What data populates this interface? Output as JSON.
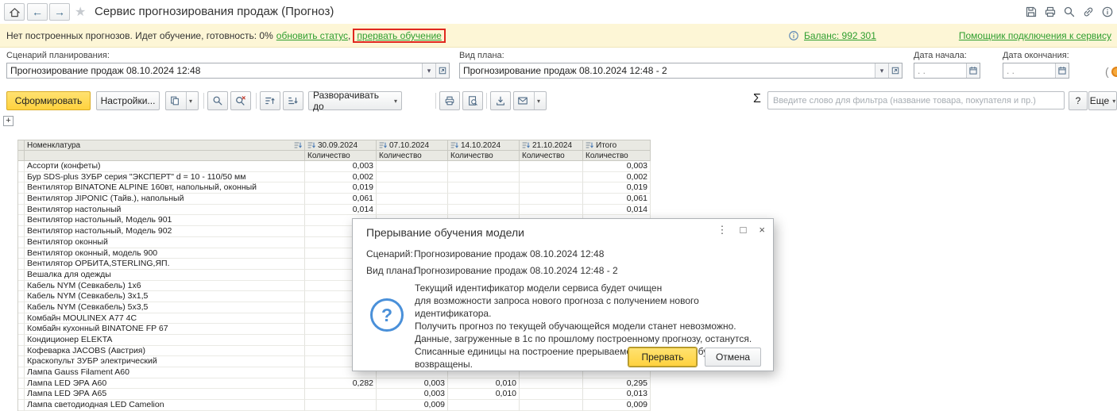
{
  "topbar": {
    "title": "Сервис прогнозирования продаж (Прогноз)"
  },
  "notification": {
    "status": "Нет построенных прогнозов. Идет обучение, готовность: 0%",
    "refresh_link": "обновить статус",
    "comma": ",",
    "interrupt_link": "прервать обучение",
    "balance_link": "Баланс: 992 301",
    "assistant_link": "Помощник подключения к сервису"
  },
  "form": {
    "scenario_label": "Сценарий планирования:",
    "scenario_value": "Прогнозирование продаж 08.10.2024 12:48",
    "plan_label": "Вид плана:",
    "plan_value": "Прогнозирование продаж 08.10.2024 12:48 - 2",
    "date_start_label": "Дата начала:",
    "date_start_value": ". .",
    "date_end_label": "Дата окончания:",
    "date_end_value": ". ."
  },
  "toolbar": {
    "generate_label": "Сформировать",
    "settings_label": "Настройки...",
    "expand_to_label": "Разворачивать до",
    "sigma": "Σ",
    "filter_placeholder": "Введите слово для фильтра (название товара, покупателя и пр.)",
    "help_label": "?",
    "more_label": "Еще"
  },
  "table": {
    "columns": [
      "Номенклатура",
      "30.09.2024",
      "07.10.2024",
      "14.10.2024",
      "21.10.2024",
      "Итого"
    ],
    "quantity_subheader": "Количество",
    "rows": [
      {
        "name": "Ассорти (конфеты)",
        "values": [
          "0,003",
          "",
          "",
          "",
          "0,003"
        ]
      },
      {
        "name": "Бур SDS-plus ЗУБР серия \"ЭКСПЕРТ\" d = 10 - 110/50 мм",
        "values": [
          "0,002",
          "",
          "",
          "",
          "0,002"
        ]
      },
      {
        "name": "Вентилятор BINATONE ALPINE 160вт, напольный, оконный",
        "values": [
          "0,019",
          "",
          "",
          "",
          "0,019"
        ]
      },
      {
        "name": "Вентилятор JIPONIC (Тайв.), напольный",
        "values": [
          "0,061",
          "",
          "",
          "",
          "0,061"
        ]
      },
      {
        "name": "Вентилятор настольный",
        "values": [
          "0,014",
          "",
          "",
          "",
          "0,014"
        ]
      },
      {
        "name": "Вентилятор настольный, Модель 901",
        "values": [
          "",
          "",
          "",
          "",
          ""
        ]
      },
      {
        "name": "Вентилятор настольный, Модель 902",
        "values": [
          "",
          "",
          "",
          "",
          ""
        ]
      },
      {
        "name": "Вентилятор оконный",
        "values": [
          "",
          "",
          "",
          "",
          ""
        ]
      },
      {
        "name": "Вентилятор оконный, модель 900",
        "values": [
          "",
          "",
          "",
          "",
          ""
        ]
      },
      {
        "name": "Вентилятор ОРБИТА,STERLING,ЯП.",
        "values": [
          "",
          "",
          "",
          "",
          ""
        ]
      },
      {
        "name": "Вешалка для одежды",
        "values": [
          "",
          "",
          "",
          "",
          ""
        ]
      },
      {
        "name": "Кабель NYM (Севкабель) 1x6",
        "values": [
          "",
          "",
          "",
          "",
          ""
        ]
      },
      {
        "name": "Кабель NYM (Севкабель) 3x1,5",
        "values": [
          "",
          "",
          "",
          "",
          ""
        ]
      },
      {
        "name": "Кабель NYM (Севкабель) 5x3,5",
        "values": [
          "",
          "",
          "",
          "",
          ""
        ]
      },
      {
        "name": "Комбайн MOULINEX А77 4С",
        "values": [
          "",
          "",
          "",
          "",
          ""
        ]
      },
      {
        "name": "Комбайн кухонный BINATONE FP 67",
        "values": [
          "",
          "",
          "",
          "",
          ""
        ]
      },
      {
        "name": "Кондиционер ELEKTA",
        "values": [
          "",
          "",
          "",
          "",
          ""
        ]
      },
      {
        "name": "Кофеварка JACOBS (Австрия)",
        "values": [
          "",
          "",
          "",
          "",
          ""
        ]
      },
      {
        "name": "Краскопульт ЗУБР электрический",
        "values": [
          "",
          "",
          "",
          "",
          ""
        ]
      },
      {
        "name": "Лампа Gauss Filament A60",
        "values": [
          "",
          "",
          "",
          "",
          ""
        ]
      },
      {
        "name": "Лампа LED ЭРА A60",
        "values": [
          "0,282",
          "0,003",
          "0,010",
          "",
          "0,295"
        ]
      },
      {
        "name": "Лампа LED ЭРА A65",
        "values": [
          "",
          "0,003",
          "0,010",
          "",
          "0,013"
        ]
      },
      {
        "name": "Лампа светодиодная LED Camelion",
        "values": [
          "",
          "0,009",
          "",
          "",
          "0,009"
        ]
      }
    ]
  },
  "dialog": {
    "title": "Прерывание обучения модели",
    "scenario_label": "Сценарий:",
    "scenario_value": "Прогнозирование продаж 08.10.2024 12:48",
    "plan_label": "Вид плана:",
    "plan_value": "Прогнозирование продаж 08.10.2024 12:48 - 2",
    "message_lines": [
      "Текущий идентификатор модели сервиса будет очищен",
      "для возможности запроса нового прогноза с получением нового идентификатора.",
      "Получить прогноз по текущей обучающейся модели станет невозможно.",
      "Данные, загруженные в 1с по прошлому построенному прогнозу, останутся.",
      "Списанные единицы на построение прерываемого прогноза не будут возвращены."
    ],
    "confirm_label": "Прервать",
    "cancel_label": "Отмена"
  },
  "icons": {
    "back": "←",
    "forward": "→",
    "star": "★",
    "dropdown": "▾",
    "dots": "⋮",
    "maximize": "□",
    "close": "×",
    "plus": "+",
    "question": "?"
  },
  "colors": {
    "accent_yellow": "#FFD23E",
    "link_green": "#2E9E2E",
    "annotation_red": "#E0281E",
    "notification_bg": "#FDF6D6"
  }
}
